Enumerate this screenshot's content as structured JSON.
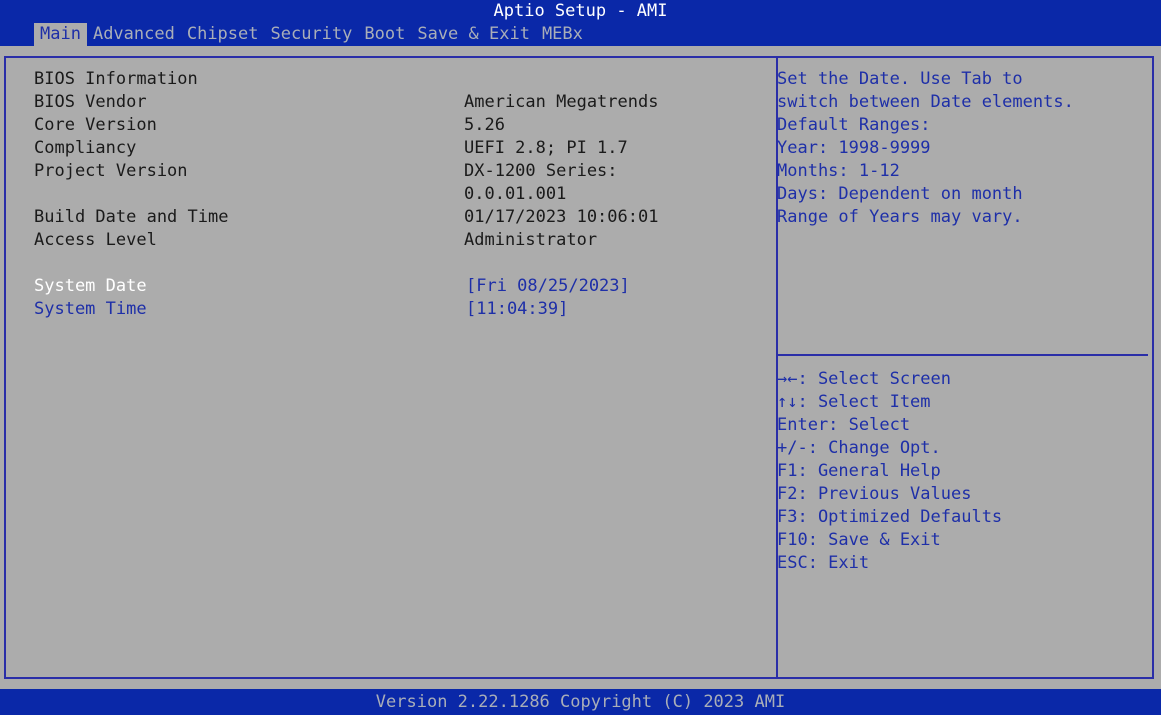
{
  "header": {
    "title": "Aptio Setup - AMI",
    "tabs": [
      {
        "label": "Main"
      },
      {
        "label": "Advanced"
      },
      {
        "label": "Chipset"
      },
      {
        "label": "Security"
      },
      {
        "label": "Boot"
      },
      {
        "label": "Save & Exit"
      },
      {
        "label": "MEBx"
      }
    ]
  },
  "info": {
    "section_title": "BIOS Information",
    "bios_vendor_label": "BIOS Vendor",
    "bios_vendor_value": "American Megatrends",
    "core_version_label": "Core Version",
    "core_version_value": "5.26",
    "compliancy_label": "Compliancy",
    "compliancy_value": "UEFI 2.8; PI 1.7",
    "project_version_label": "Project Version",
    "project_version_value_1": "DX-1200 Series:",
    "project_version_value_2": "0.0.01.001",
    "build_date_label": "Build Date and Time",
    "build_date_value": "01/17/2023 10:06:01",
    "access_level_label": "Access Level",
    "access_level_value": "Administrator"
  },
  "settings": {
    "system_date_label": "System Date",
    "system_date_value": "[Fri 08/25/2023]",
    "system_time_label": "System Time",
    "system_time_value": "[11:04:39]"
  },
  "help": {
    "lines": [
      "Set the Date. Use Tab to",
      "switch between Date elements.",
      "Default Ranges:",
      "Year: 1998-9999",
      "Months: 1-12",
      "Days: Dependent on month",
      "Range of Years may vary."
    ]
  },
  "keys": {
    "lines": [
      "→←: Select Screen",
      "↑↓: Select Item",
      "Enter: Select",
      "+/-: Change Opt.",
      "F1: General Help",
      "F2: Previous Values",
      "F3: Optimized Defaults",
      "F10: Save & Exit",
      "ESC: Exit"
    ]
  },
  "footer": {
    "text": "Version 2.22.1286 Copyright (C) 2023 AMI"
  },
  "colors": {
    "bar_background": "#0a28a8",
    "panel_background": "#acacac",
    "highlight_text": "#ffffff",
    "option_text": "#1e2fa8",
    "static_text": "#1a1a1a"
  }
}
